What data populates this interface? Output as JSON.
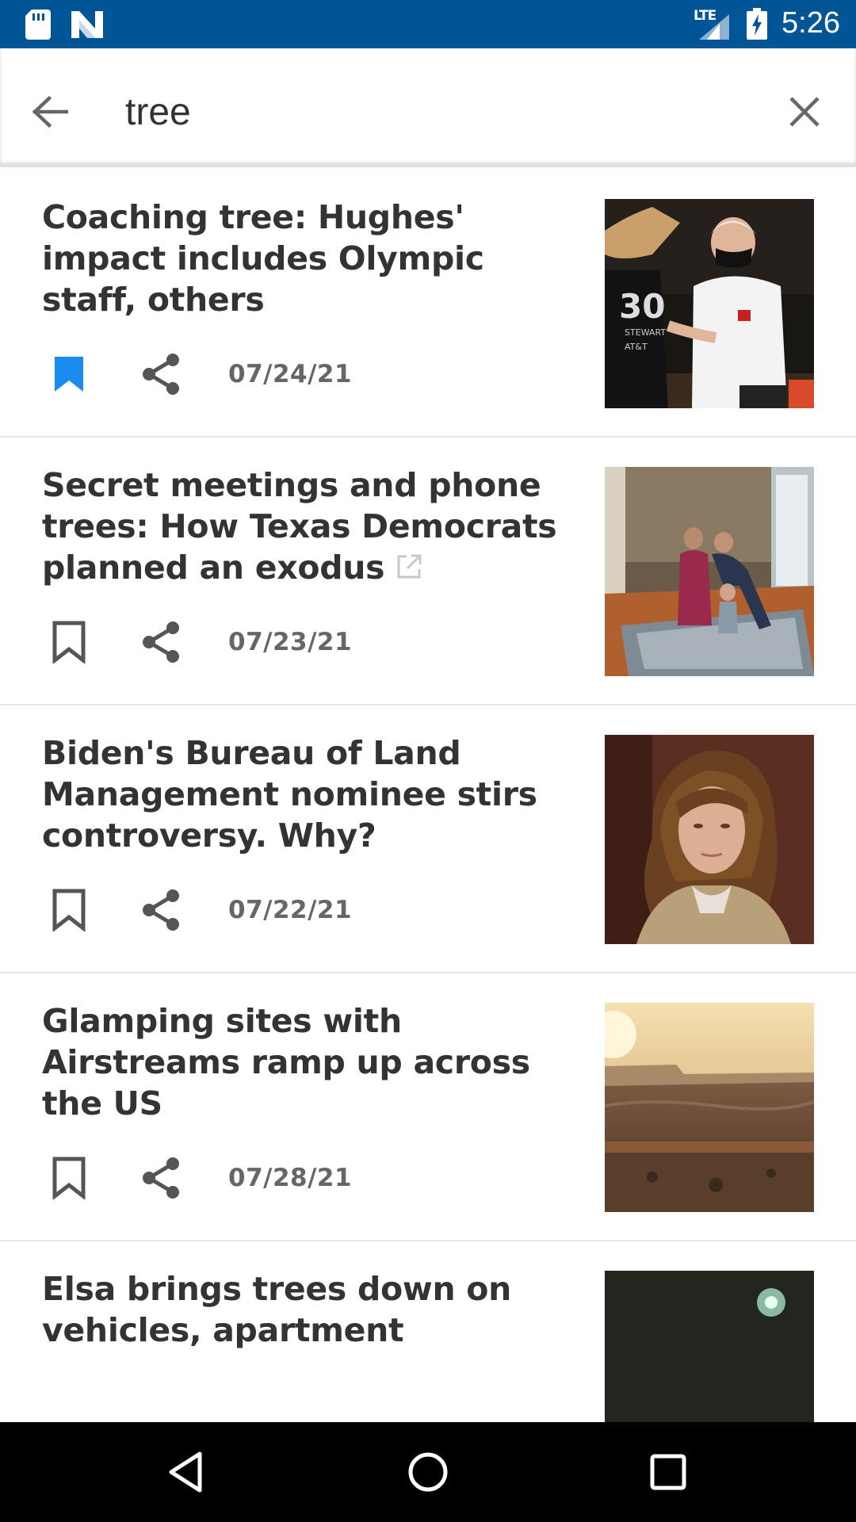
{
  "status_bar": {
    "network": "LTE",
    "time": "5:26",
    "icons": [
      "sd-card-icon",
      "n-logo-icon",
      "signal-icon",
      "battery-charging-icon"
    ]
  },
  "search": {
    "query": "tree",
    "icons": [
      "arrow-left-icon",
      "close-icon"
    ]
  },
  "results": [
    {
      "headline": "Coaching tree: Hughes' impact includes Olympic staff, others",
      "date": "07/24/21",
      "bookmarked": true,
      "external": false
    },
    {
      "headline": "Secret meetings and phone trees: How Texas Democrats planned an exodus",
      "date": "07/23/21",
      "bookmarked": false,
      "external": true
    },
    {
      "headline": "Biden's Bureau of Land Management nominee stirs controversy. Why?",
      "date": "07/22/21",
      "bookmarked": false,
      "external": false
    },
    {
      "headline": "Glamping sites with Airstreams ramp up across the US",
      "date": "07/28/21",
      "bookmarked": false,
      "external": false
    },
    {
      "headline": "Elsa brings trees down on vehicles, apartment",
      "date": "",
      "bookmarked": false,
      "external": false
    }
  ],
  "colors": {
    "status_bar": "#005596",
    "bookmark_active": "#1a8cf0",
    "icon_gray": "#555555",
    "date_gray": "#666666",
    "headline": "#333333"
  },
  "nav_bar": {
    "icons": [
      "triangle-back-icon",
      "circle-home-icon",
      "square-recents-icon"
    ]
  }
}
